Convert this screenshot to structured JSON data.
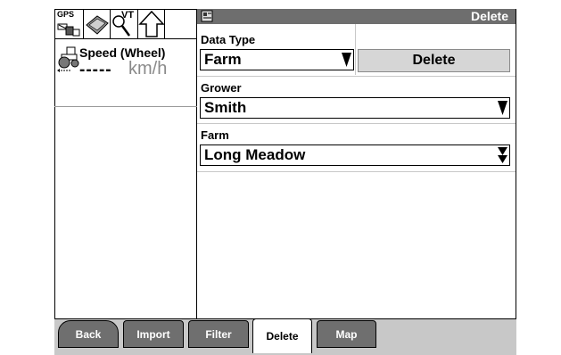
{
  "status_bar": {
    "gps_label": "GPS",
    "vt_label": "VT"
  },
  "speed": {
    "label": "Speed (Wheel)",
    "value": "-----",
    "unit": "km/h"
  },
  "header": {
    "title": "Delete"
  },
  "data_type": {
    "label": "Data Type",
    "value": "Farm"
  },
  "delete_button": "Delete",
  "grower": {
    "label": "Grower",
    "value": "Smith"
  },
  "farm": {
    "label": "Farm",
    "value": "Long Meadow"
  },
  "tabs": [
    {
      "label": "Back"
    },
    {
      "label": "Import"
    },
    {
      "label": "Filter"
    },
    {
      "label": "Delete",
      "active": true
    },
    {
      "label": "Map"
    }
  ],
  "colors": {
    "header_bg": "#6e6e6e",
    "tab_bg": "#6f6f6f",
    "tabbar_bg": "#c8c8c8",
    "button_bg": "#d6d6d6"
  }
}
